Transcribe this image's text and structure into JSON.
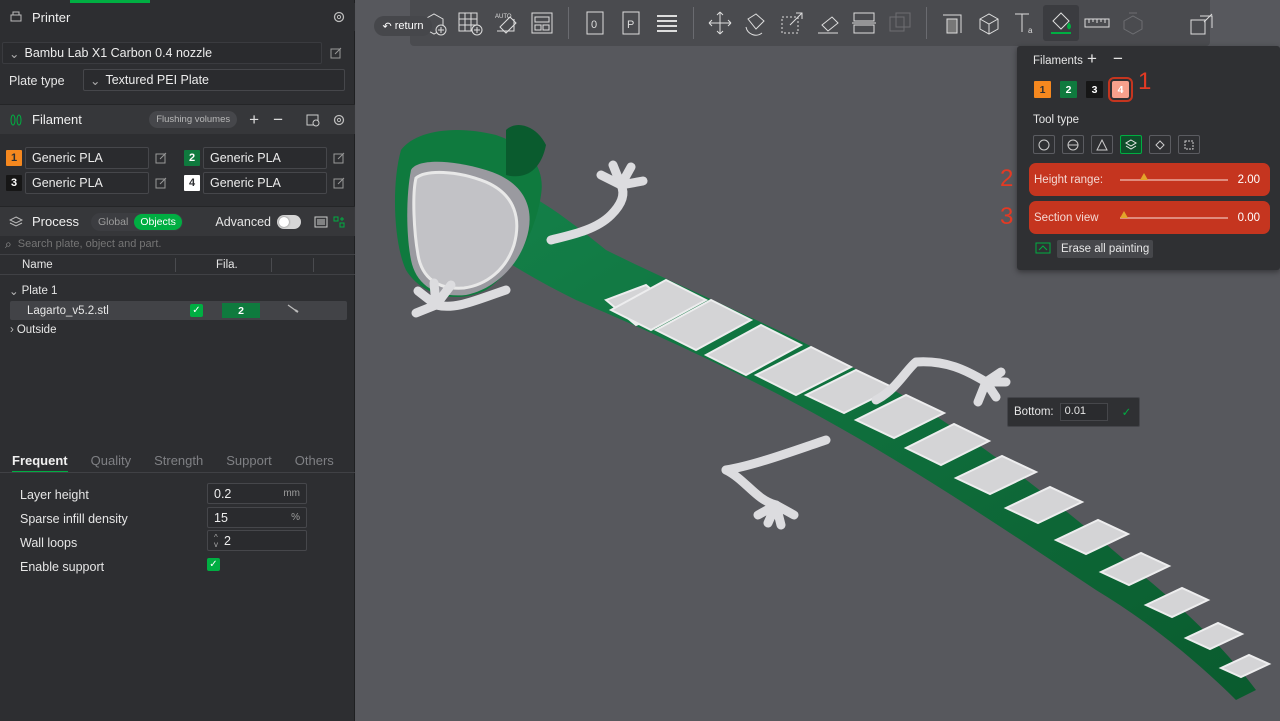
{
  "printer": {
    "section_title": "Printer",
    "model": "Bambu Lab X1 Carbon 0.4 nozzle",
    "plate_type_label": "Plate type",
    "plate_type": "Textured PEI Plate"
  },
  "filament": {
    "section_title": "Filament",
    "flushing_label": "Flushing volumes",
    "slots": [
      {
        "num": "1",
        "name": "Generic PLA",
        "color": "#f5881f"
      },
      {
        "num": "2",
        "name": "Generic PLA",
        "color": "#0f7a3e"
      },
      {
        "num": "3",
        "name": "Generic PLA",
        "color": "#161616"
      },
      {
        "num": "4",
        "name": "Generic PLA",
        "color": "#ffffff"
      }
    ]
  },
  "process": {
    "section_title": "Process",
    "global_label": "Global",
    "objects_label": "Objects",
    "advanced_label": "Advanced",
    "search_placeholder": "Search plate, object and part.",
    "columns": {
      "name": "Name",
      "fila": "Fila."
    },
    "tree": {
      "plate": "Plate 1",
      "object": "Lagarto_v5.2.stl",
      "object_filament": "2",
      "outside": "Outside"
    }
  },
  "settings": {
    "tabs": [
      "Frequent",
      "Quality",
      "Strength",
      "Support",
      "Others"
    ],
    "layer_height": {
      "label": "Layer height",
      "value": "0.2",
      "unit": "mm"
    },
    "sparse_infill": {
      "label": "Sparse infill density",
      "value": "15",
      "unit": "%"
    },
    "wall_loops": {
      "label": "Wall loops",
      "value": "2"
    },
    "enable_support": {
      "label": "Enable support",
      "checked": true
    }
  },
  "viewport": {
    "return_label": "return",
    "auto_label": "AUTO",
    "paint": {
      "filaments_label": "Filaments",
      "filaments": [
        {
          "num": "1",
          "color": "#f5881f"
        },
        {
          "num": "2",
          "color": "#0f7a3e"
        },
        {
          "num": "3",
          "color": "#161616"
        },
        {
          "num": "4",
          "color": "#f7a08c"
        }
      ],
      "tool_type_label": "Tool type",
      "height_range": {
        "label": "Height range:",
        "value": "2.00",
        "level": 0.2
      },
      "section_view": {
        "label": "Section view",
        "value": "0.00",
        "level": 0.0
      },
      "erase_label": "Erase all painting"
    },
    "annotations": [
      "1",
      "2",
      "3"
    ],
    "bottom_popup": {
      "label": "Bottom:",
      "value": "0.01"
    }
  },
  "colors": {
    "accent": "#00ae42",
    "highlight": "#c5351f",
    "model_green": "#0e6a33"
  }
}
